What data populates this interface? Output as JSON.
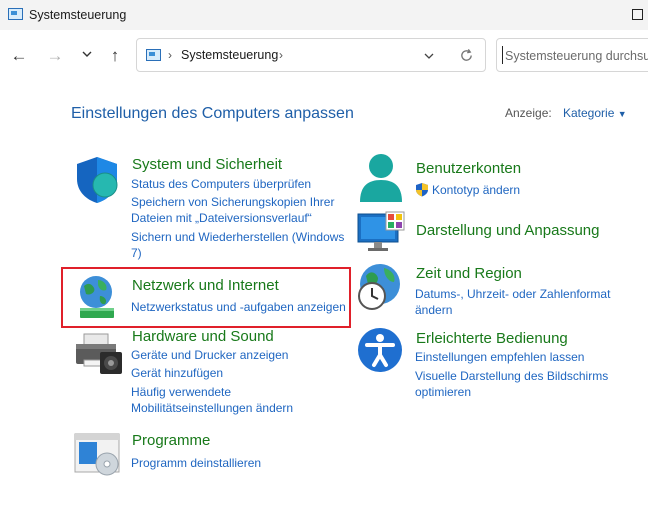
{
  "window": {
    "title": "Systemsteuerung"
  },
  "address": {
    "crumb": "Systemsteuerung",
    "search_placeholder": "Systemsteuerung durchsuchen"
  },
  "heading": "Einstellungen des Computers anpassen",
  "view": {
    "label": "Anzeige:",
    "value": "Kategorie"
  },
  "categories": {
    "system": {
      "title": "System und Sicherheit",
      "links": [
        "Status des Computers überprüfen",
        "Speichern von Sicherungskopien Ihrer",
        "Dateien mit „Dateiversionsverlauf“",
        "Sichern und Wiederherstellen (Windows",
        "7)"
      ]
    },
    "network": {
      "title": "Netzwerk und Internet",
      "links": [
        "Netzwerkstatus und -aufgaben anzeigen"
      ]
    },
    "hardware": {
      "title": "Hardware und Sound",
      "links": [
        "Geräte und Drucker anzeigen",
        "Gerät hinzufügen",
        "Häufig verwendete",
        "Mobilitätseinstellungen ändern"
      ]
    },
    "programs": {
      "title": "Programme",
      "links": [
        "Programm deinstallieren"
      ]
    },
    "users": {
      "title": "Benutzerkonten",
      "links": [
        "Kontotyp ändern"
      ]
    },
    "appearance": {
      "title": "Darstellung und Anpassung",
      "links": []
    },
    "region": {
      "title": "Zeit und Region",
      "links": [
        "Datums-, Uhrzeit- oder Zahlenformat",
        "ändern"
      ]
    },
    "ease": {
      "title": "Erleichterte Bedienung",
      "links": [
        "Einstellungen empfehlen lassen",
        "Visuelle Darstellung des Bildschirms",
        "optimieren"
      ]
    }
  },
  "colors": {
    "link": "#1f66c1",
    "category": "#18791a",
    "heading": "#1f5fa8",
    "highlight": "#e0202a"
  },
  "icons": [
    "back-icon",
    "forward-icon",
    "chevron-down-icon",
    "up-icon",
    "refresh-icon",
    "shield-icon",
    "network-globe-icon",
    "printer-icon",
    "programs-icon",
    "user-icon",
    "uac-shield-icon",
    "monitor-icon",
    "clock-globe-icon",
    "accessibility-icon"
  ]
}
